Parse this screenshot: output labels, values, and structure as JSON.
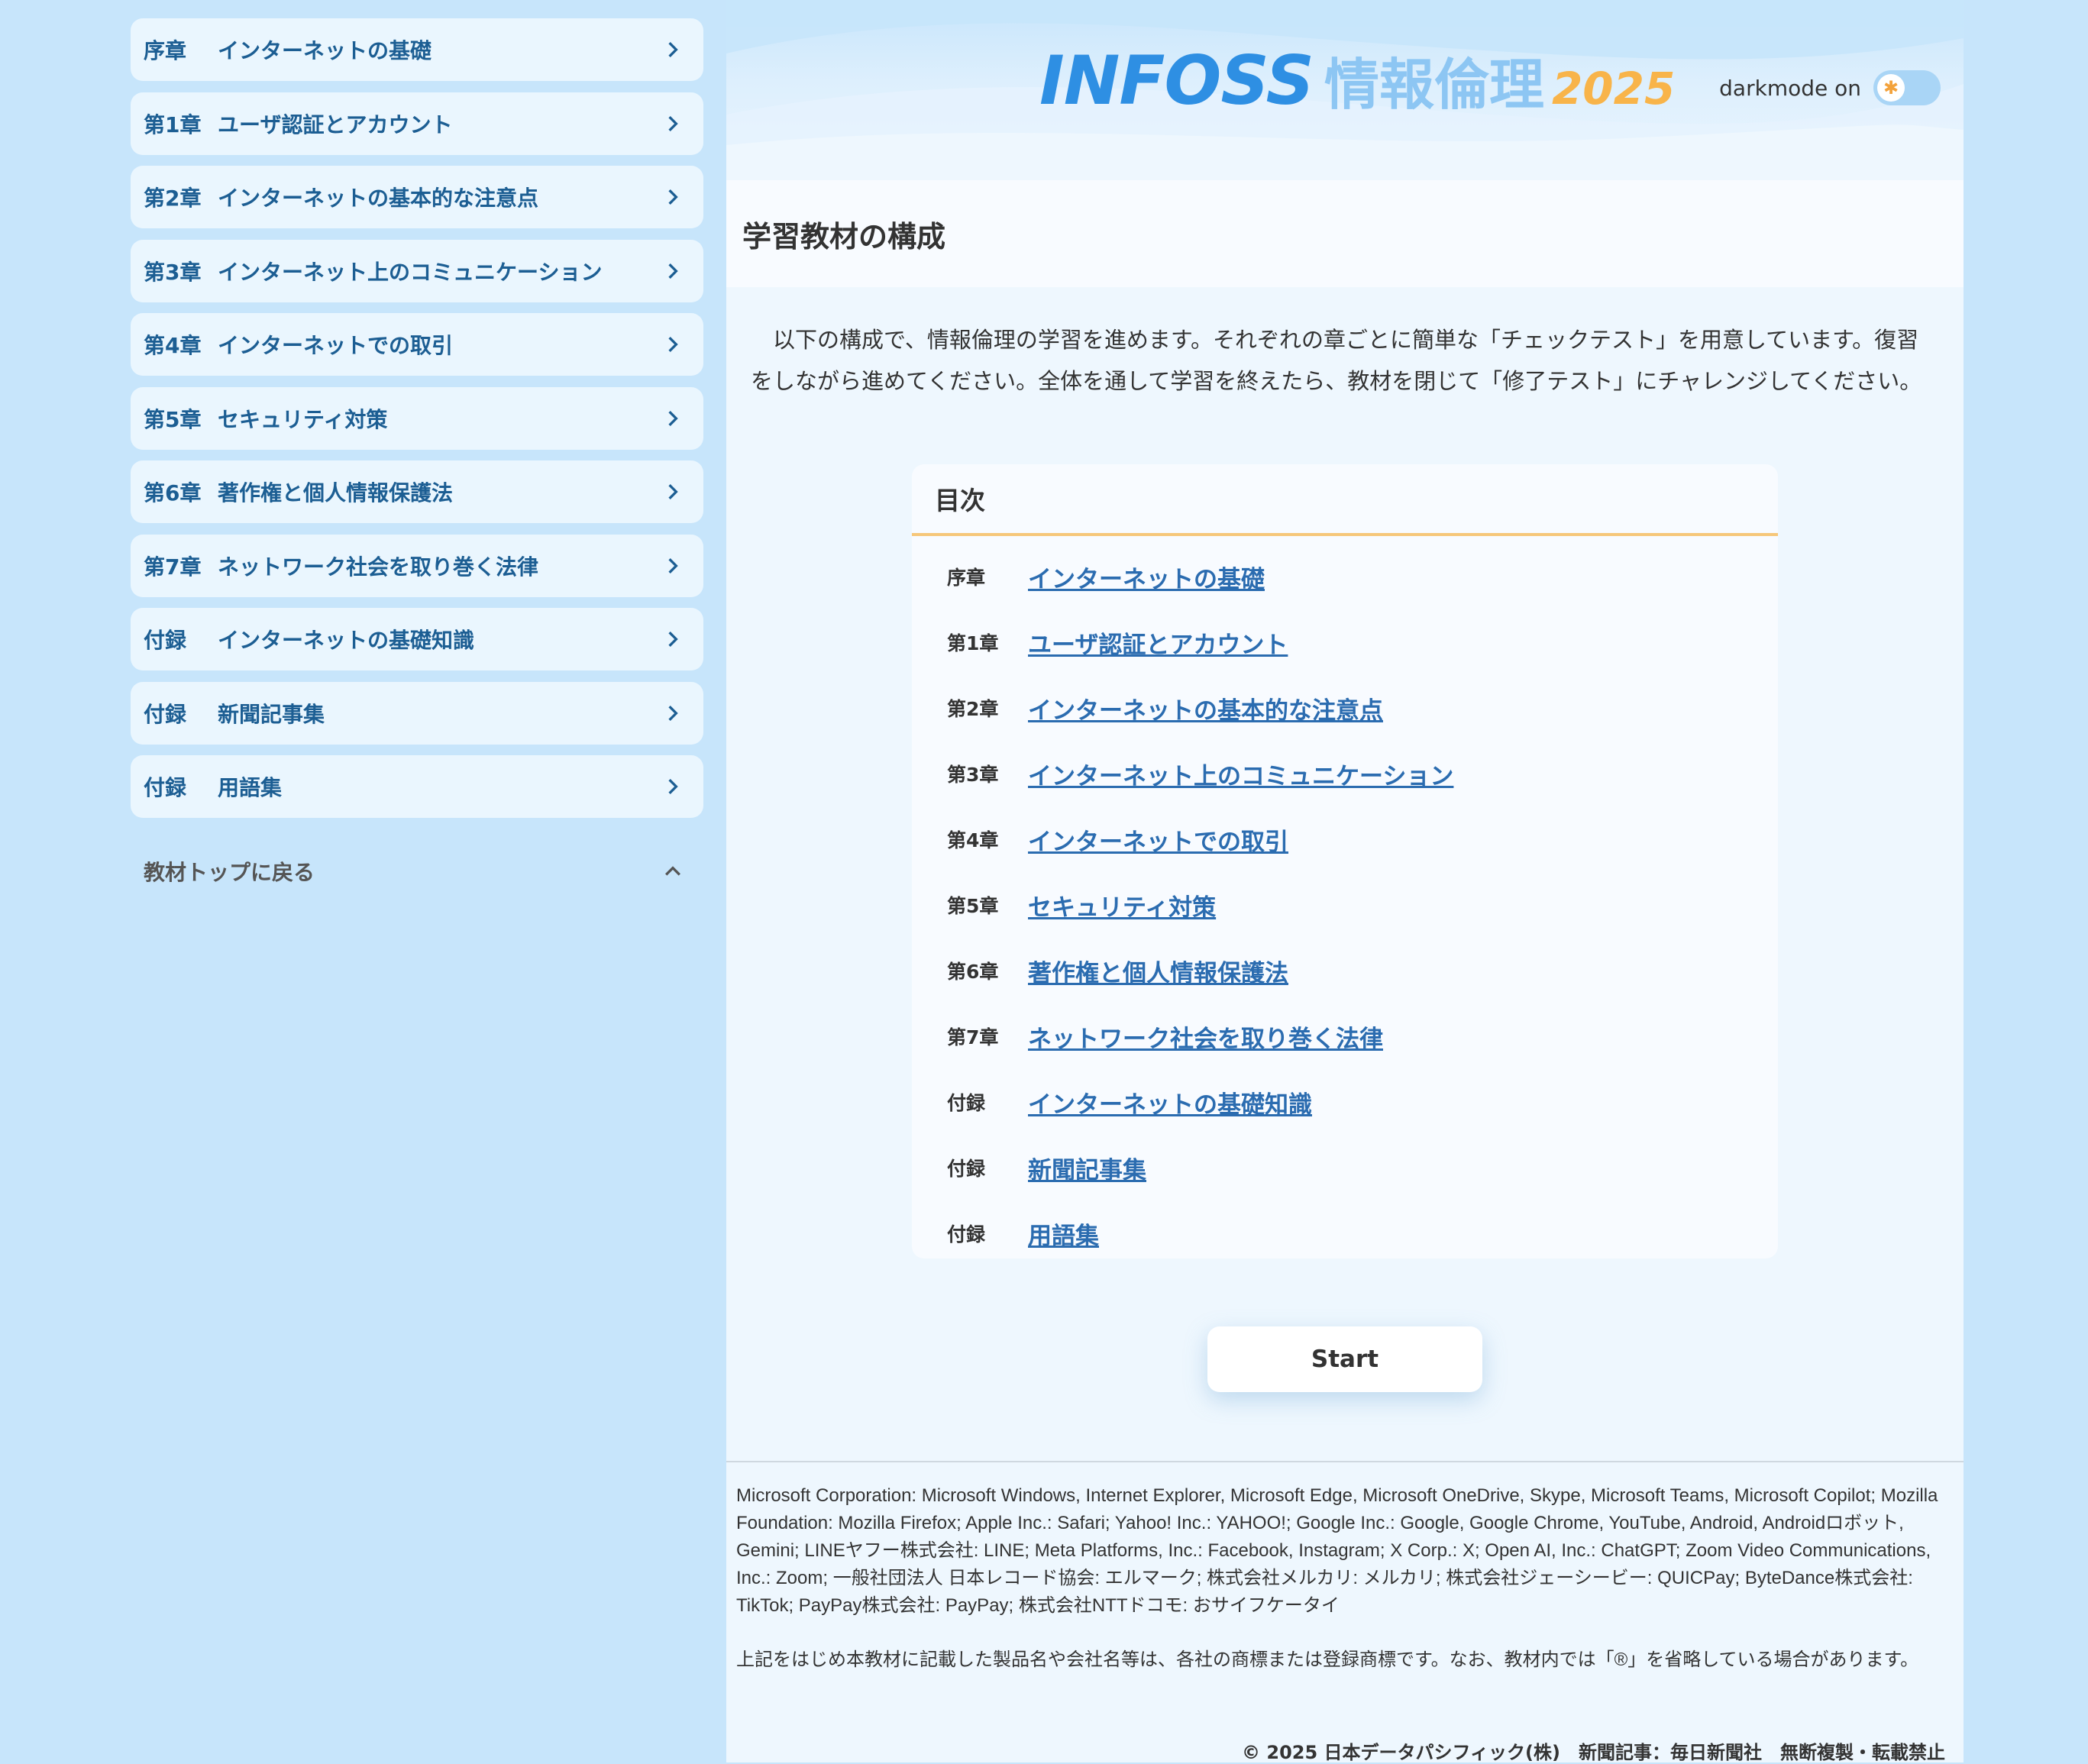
{
  "sidebar": {
    "items": [
      {
        "num": "序章",
        "title": "インターネットの基礎"
      },
      {
        "num": "第1章",
        "title": "ユーザ認証とアカウント"
      },
      {
        "num": "第2章",
        "title": "インターネットの基本的な注意点"
      },
      {
        "num": "第3章",
        "title": "インターネット上のコミュニケーション"
      },
      {
        "num": "第4章",
        "title": "インターネットでの取引"
      },
      {
        "num": "第5章",
        "title": "セキュリティ対策"
      },
      {
        "num": "第6章",
        "title": "著作権と個人情報保護法"
      },
      {
        "num": "第7章",
        "title": "ネットワーク社会を取り巻く法律"
      },
      {
        "num": "付録",
        "title": "インターネットの基礎知識"
      },
      {
        "num": "付録",
        "title": "新聞記事集"
      },
      {
        "num": "付録",
        "title": "用語集"
      }
    ],
    "back_top": "教材トップに戻る"
  },
  "header": {
    "logo_main": "INFOSS",
    "logo_sub": "情報倫理",
    "logo_year": "2025",
    "darkmode_label": "darkmode on"
  },
  "main": {
    "section_title": "学習教材の構成",
    "intro": "以下の構成で、情報倫理の学習を進めます。それぞれの章ごとに簡単な「チェックテスト」を用意しています。復習をしながら進めてください。全体を通して学習を終えたら、教材を閉じて「修了テスト」にチャレンジしてください。",
    "toc_title": "目次",
    "toc": [
      {
        "num": "序章",
        "title": "インターネットの基礎"
      },
      {
        "num": "第1章",
        "title": "ユーザ認証とアカウント"
      },
      {
        "num": "第2章",
        "title": "インターネットの基本的な注意点"
      },
      {
        "num": "第3章",
        "title": "インターネット上のコミュニケーション"
      },
      {
        "num": "第4章",
        "title": "インターネットでの取引"
      },
      {
        "num": "第5章",
        "title": "セキュリティ対策"
      },
      {
        "num": "第6章",
        "title": "著作権と個人情報保護法"
      },
      {
        "num": "第7章",
        "title": "ネットワーク社会を取り巻く法律"
      },
      {
        "num": "付録",
        "title": "インターネットの基礎知識"
      },
      {
        "num": "付録",
        "title": "新聞記事集"
      },
      {
        "num": "付録",
        "title": "用語集"
      }
    ],
    "start_label": "Start"
  },
  "footer": {
    "credits": "Microsoft Corporation: Microsoft Windows, Internet Explorer, Microsoft Edge, Microsoft OneDrive, Skype, Microsoft Teams, Microsoft Copilot; Mozilla Foundation: Mozilla Firefox; Apple Inc.: Safari; Yahoo! Inc.: YAHOO!; Google Inc.: Google, Google Chrome, YouTube, Android, Androidロボット, Gemini; LINEヤフー株式会社: LINE; Meta Platforms, Inc.: Facebook, Instagram; X Corp.: X; Open AI, Inc.: ChatGPT; Zoom Video Communications, Inc.: Zoom; 一般社団法人 日本レコード協会: エルマーク; 株式会社メルカリ: メルカリ; 株式会社ジェーシービー: QUICPay; ByteDance株式会社: TikTok; PayPay株式会社: PayPay; 株式会社NTTドコモ: おサイフケータイ",
    "notice": "上記をはじめ本教材に記載した製品名や会社名等は、各社の商標または登録商標です。なお、教材内では「®」を省略している場合があります。",
    "copyright": "© 2025 日本データパシフィック(株)　新聞記事：毎日新聞社　無断複製・転載禁止"
  },
  "colors": {
    "page_bg": "#c7e5fb",
    "sidebar_item_bg": "#eaf6fe",
    "sidebar_text": "#1c5e93",
    "link": "#2b6cb0",
    "toc_divider": "#f6c77a",
    "logo_blue": "#2e8fe3",
    "logo_orange": "#f8b44a"
  },
  "icons": {
    "chevron": "chevron-right-icon",
    "collapse": "chevron-up-icon",
    "sun": "sun-icon"
  }
}
